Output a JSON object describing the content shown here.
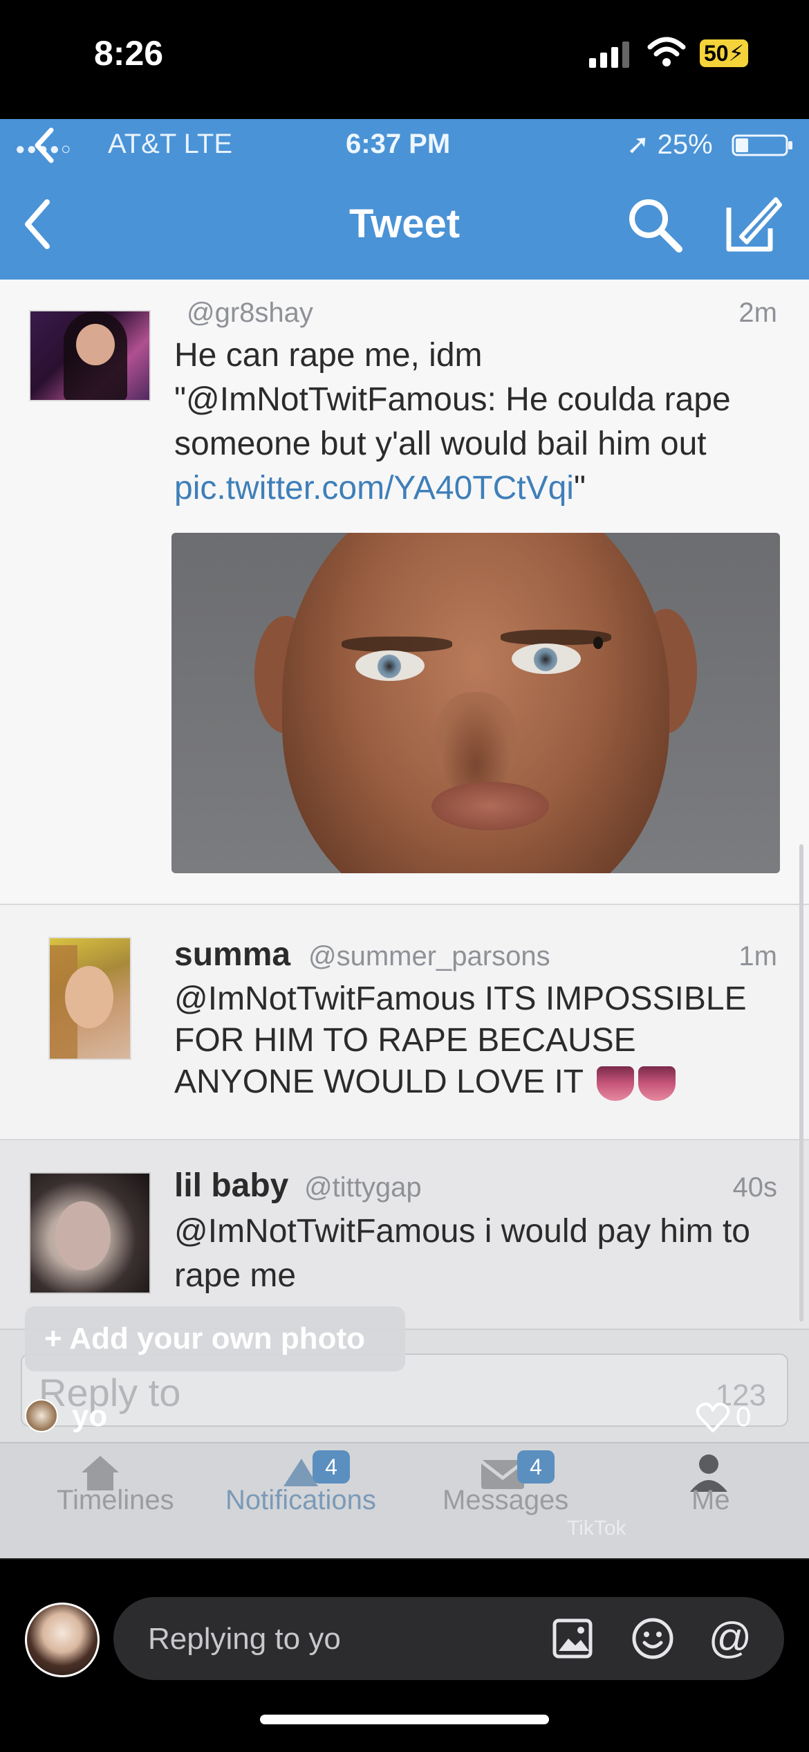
{
  "os_status": {
    "time": "8:26",
    "battery": "50"
  },
  "inner_status": {
    "carrier": "AT&T  LTE",
    "time": "6:37 PM",
    "battery": "25%"
  },
  "nav": {
    "title": "Tweet"
  },
  "main_tweet": {
    "handle": "@gr8shay",
    "time": "2m",
    "text_line1": "He can rape me, idm",
    "text_line2": "\"@ImNotTwitFamous: He coulda rape someone but y'all would bail him out",
    "link": "pic.twitter.com/YA40TCtVqi",
    "quote_close": "\""
  },
  "replies": [
    {
      "name": "summa",
      "handle": "@summer_parsons",
      "time": "1m",
      "text": "@ImNotTwitFamous ITS IMPOSSIBLE FOR HIM TO RAPE BECAUSE ANYONE WOULD LOVE IT"
    },
    {
      "name": "lil baby",
      "handle": "@tittygap",
      "time": "40s",
      "text": "@ImNotTwitFamous i would pay him to rape me"
    }
  ],
  "composer": {
    "placeholder": "Reply to",
    "char_count": "123"
  },
  "tabbar": {
    "timelines": "Timelines",
    "notifications": "Notifications",
    "notifications_badge": "4",
    "messages": "Messages",
    "messages_badge": "4",
    "me": "Me"
  },
  "overlay": {
    "add_photo": "+ Add your own photo",
    "username": "yo",
    "like_count": "0",
    "watermark": "TikTok"
  },
  "bottom_bar": {
    "reply_placeholder": "Replying to yo"
  }
}
